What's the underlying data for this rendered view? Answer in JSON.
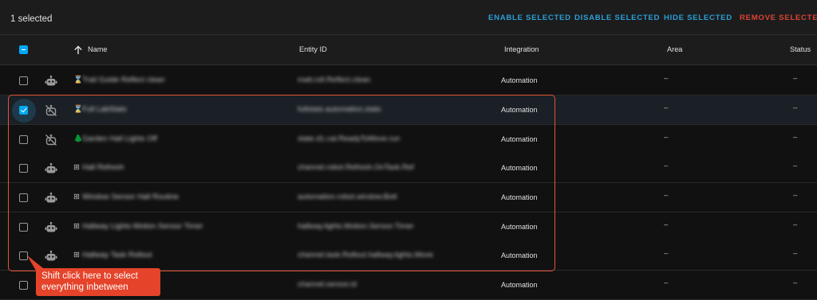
{
  "selection_bar": {
    "count_label": "1 selected",
    "actions": [
      {
        "label": "ENABLE SELECTED",
        "kind": "normal"
      },
      {
        "label": "DISABLE SELECTED",
        "kind": "normal"
      },
      {
        "label": "HIDE SELECTED",
        "kind": "normal"
      },
      {
        "label": "REMOVE SELECTED",
        "kind": "danger"
      }
    ]
  },
  "table": {
    "columns": {
      "name": "Name",
      "entity_id": "Entity ID",
      "integration": "Integration",
      "area": "Area",
      "status": "Status"
    },
    "sort_icon": "arrow-up-icon",
    "rows": [
      {
        "icon": "robot-icon",
        "glyph": "⌛",
        "name": "Trail Guide Reflect clean",
        "entity_id": "matt.roll.Reflect.clean",
        "integration": "Automation",
        "area": "–",
        "status": "–",
        "checked": false
      },
      {
        "icon": "robot-off-icon",
        "glyph": "⌛",
        "name": "Full LabStats",
        "entity_id": "fullstats.automation.stats",
        "integration": "Automation",
        "area": "–",
        "status": "–",
        "checked": true
      },
      {
        "icon": "robot-off-icon",
        "glyph": "🌲",
        "name": "Garden Hall Lights Off",
        "entity_id": "state.d1.cal.ReadyToMove.run",
        "integration": "Automation",
        "area": "–",
        "status": "–",
        "checked": false
      },
      {
        "icon": "robot-icon",
        "glyph": "⊞",
        "name": "Hall Refresh",
        "entity_id": "channel.robot.Refresh.OnTask.Ref",
        "integration": "Automation",
        "area": "–",
        "status": "–",
        "checked": false
      },
      {
        "icon": "robot-icon",
        "glyph": "⊞",
        "name": "Window Sensor Hall Routine",
        "entity_id": "automation.robot.window.Bott",
        "integration": "Automation",
        "area": "–",
        "status": "–",
        "checked": false
      },
      {
        "icon": "robot-icon",
        "glyph": "⊞",
        "name": "Hallway Lights Motion Sensor Timer",
        "entity_id": "hallway.lights.Motion.Sensor.Timer",
        "integration": "Automation",
        "area": "–",
        "status": "–",
        "checked": false
      },
      {
        "icon": "robot-icon",
        "glyph": "⊞",
        "name": "Hallway Task Rollout",
        "entity_id": "channel.task.Rollout.hallway.lights.Move",
        "integration": "Automation",
        "area": "–",
        "status": "–",
        "checked": false
      },
      {
        "icon": "robot-icon",
        "glyph": "⊞",
        "name": "",
        "entity_id": "channel.sensor.id",
        "integration": "Automation",
        "area": "–",
        "status": "–",
        "checked": false
      }
    ]
  },
  "annotation": {
    "callout_text": "Shift click here to select everything inbetween",
    "color": "#e5432a"
  },
  "colors": {
    "accent": "#03a9f4",
    "action_blue": "#2a9fd8",
    "danger": "#db4437"
  }
}
